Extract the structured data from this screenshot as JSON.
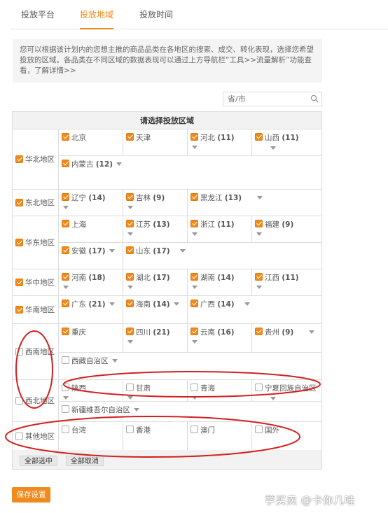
{
  "tabs": [
    {
      "label": "投放平台",
      "active": false
    },
    {
      "label": "投放地域",
      "active": true
    },
    {
      "label": "投放时间",
      "active": false
    }
  ],
  "notice": "您可以根据该计划内的您想主推的商品品类在各地区的搜索、成交、转化表现，选择您希望投放的区域。各品类在不同区域的数据表现可以通过上方导航栏“工具>>流量解析”功能查看，了解详情>>",
  "search": {
    "placeholder": "省/市"
  },
  "grid": {
    "header": "请选择投放区域",
    "regions": [
      {
        "name": "华北地区",
        "checked": true,
        "rows": [
          [
            {
              "name": "北京",
              "count": "",
              "checked": true,
              "dropdown": false
            },
            {
              "name": "天津",
              "count": "",
              "checked": true,
              "dropdown": false
            },
            {
              "name": "河北",
              "count": "(11)",
              "checked": true,
              "dropdown": true
            },
            {
              "name": "山西",
              "count": "(11)",
              "checked": true,
              "dropdown": true
            }
          ],
          [
            {
              "name": "内蒙古",
              "count": "(12)",
              "checked": true,
              "dropdown": true
            }
          ]
        ]
      },
      {
        "name": "东北地区",
        "checked": true,
        "rows": [
          [
            {
              "name": "辽宁",
              "count": "(14)",
              "checked": true,
              "dropdown": true
            },
            {
              "name": "吉林",
              "count": "(9)",
              "checked": true,
              "dropdown": true
            },
            {
              "name": "黑龙江",
              "count": "(13)",
              "checked": true,
              "dropdown": true
            }
          ]
        ]
      },
      {
        "name": "华东地区",
        "checked": true,
        "rows": [
          [
            {
              "name": "上海",
              "count": "",
              "checked": true,
              "dropdown": false
            },
            {
              "name": "江苏",
              "count": "(13)",
              "checked": true,
              "dropdown": true
            },
            {
              "name": "浙江",
              "count": "(11)",
              "checked": true,
              "dropdown": true
            },
            {
              "name": "福建",
              "count": "(9)",
              "checked": true,
              "dropdown": true
            }
          ],
          [
            {
              "name": "安徽",
              "count": "(17)",
              "checked": true,
              "dropdown": true
            },
            {
              "name": "山东",
              "count": "(17)",
              "checked": true,
              "dropdown": true
            }
          ]
        ]
      },
      {
        "name": "华中地区",
        "checked": true,
        "rows": [
          [
            {
              "name": "河南",
              "count": "(18)",
              "checked": true,
              "dropdown": true
            },
            {
              "name": "湖北",
              "count": "(17)",
              "checked": true,
              "dropdown": true
            },
            {
              "name": "湖南",
              "count": "(14)",
              "checked": true,
              "dropdown": true
            },
            {
              "name": "江西",
              "count": "(11)",
              "checked": true,
              "dropdown": true
            }
          ]
        ]
      },
      {
        "name": "华南地区",
        "checked": true,
        "rows": [
          [
            {
              "name": "广东",
              "count": "(21)",
              "checked": true,
              "dropdown": true
            },
            {
              "name": "海南",
              "count": "(14)",
              "checked": true,
              "dropdown": true
            },
            {
              "name": "广西",
              "count": "(14)",
              "checked": true,
              "dropdown": true
            }
          ]
        ]
      },
      {
        "name": "西南地区",
        "checked": false,
        "rows": [
          [
            {
              "name": "重庆",
              "count": "",
              "checked": true,
              "dropdown": false
            },
            {
              "name": "四川",
              "count": "(21)",
              "checked": true,
              "dropdown": true
            },
            {
              "name": "云南",
              "count": "(16)",
              "checked": true,
              "dropdown": true
            },
            {
              "name": "贵州",
              "count": "(9)",
              "checked": true,
              "dropdown": true
            }
          ],
          [
            {
              "name": "西藏自治区",
              "count": "",
              "checked": false,
              "dropdown": true
            }
          ]
        ]
      },
      {
        "name": "西北地区",
        "checked": false,
        "rows": [
          [
            {
              "name": "陕西",
              "count": "",
              "checked": false,
              "dropdown": true
            },
            {
              "name": "甘肃",
              "count": "",
              "checked": false,
              "dropdown": true
            },
            {
              "name": "青海",
              "count": "",
              "checked": false,
              "dropdown": true
            },
            {
              "name": "宁夏回族自治区",
              "count": "",
              "checked": false,
              "dropdown": true
            }
          ],
          [
            {
              "name": "新疆维吾尔自治区",
              "count": "",
              "checked": false,
              "dropdown": true
            }
          ]
        ]
      },
      {
        "name": "其他地区",
        "checked": false,
        "rows": [
          [
            {
              "name": "台湾",
              "count": "",
              "checked": false,
              "dropdown": false
            },
            {
              "name": "香港",
              "count": "",
              "checked": false,
              "dropdown": false
            },
            {
              "name": "澳门",
              "count": "",
              "checked": false,
              "dropdown": false
            },
            {
              "name": "国外",
              "count": "",
              "checked": false,
              "dropdown": false
            }
          ]
        ]
      }
    ]
  },
  "buttons": {
    "select_all": "全部选中",
    "deselect_all": "全部取消"
  },
  "save_label": "保存设置",
  "watermark": "学买卖 @卡你几哇",
  "colors": {
    "accent": "#f08a1c",
    "annotation": "#d32020"
  }
}
